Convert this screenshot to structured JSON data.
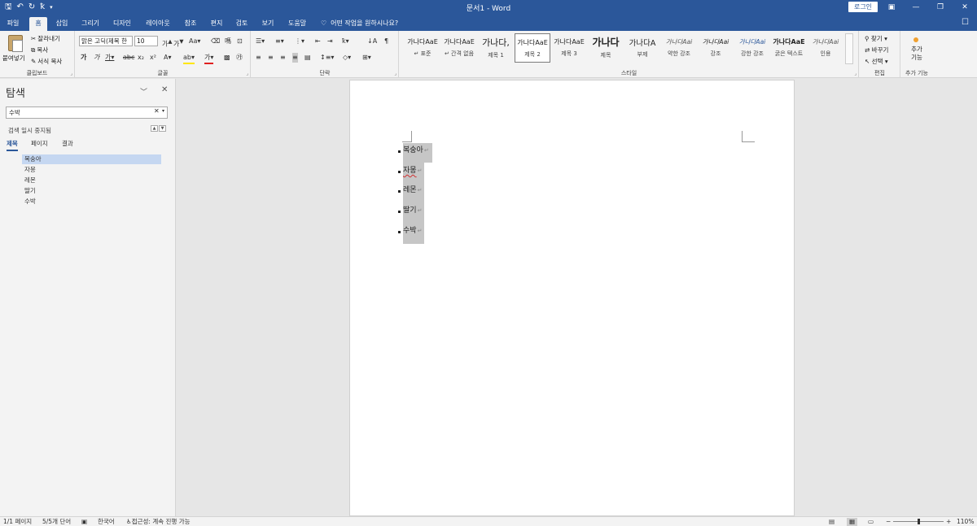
{
  "titlebar": {
    "title": "문서1 - Word",
    "login": "로그인",
    "qat": {
      "save_icon": "save-icon",
      "undo_icon": "undo-icon",
      "redo_icon": "redo-icon",
      "spell_icon": "spellcheck-icon",
      "customize_icon": "customize-icon"
    },
    "colors": {
      "brand": "#2b579a"
    }
  },
  "tabs": [
    "파일",
    "홈",
    "삽입",
    "그리기",
    "디자인",
    "레이아웃",
    "참조",
    "편지",
    "검토",
    "보기",
    "도움말"
  ],
  "tell_me": "어떤 작업을 원하시나요?",
  "ribbon": {
    "clipboard": {
      "paste": "붙여넣기",
      "cut": "잘라내기",
      "copy": "복사",
      "format_painter": "서식 복사",
      "label": "클립보드"
    },
    "font": {
      "name": "맑은 고딕(제목 한",
      "size": "10",
      "label": "글꼴"
    },
    "paragraph": {
      "label": "단락"
    },
    "styles": {
      "label": "스타일",
      "items": [
        {
          "sample": "가나다AaE",
          "name": "↵ 표준"
        },
        {
          "sample": "가나다AaE",
          "name": "↵ 간격 없음"
        },
        {
          "sample": "가나다,",
          "name": "제목 1"
        },
        {
          "sample": "가나다AaE",
          "name": "제목 2"
        },
        {
          "sample": "가나다AaE",
          "name": "제목 3"
        },
        {
          "sample": "가나다",
          "name": "제목"
        },
        {
          "sample": "가나다A",
          "name": "부제"
        },
        {
          "sample": "가나다Aai",
          "name": "약한 강조"
        },
        {
          "sample": "가나다Aai",
          "name": "강조"
        },
        {
          "sample": "가나다Aai",
          "name": "강한 강조"
        },
        {
          "sample": "가나다AaE",
          "name": "굵은 텍스트"
        },
        {
          "sample": "가나다Aai",
          "name": "인용"
        }
      ]
    },
    "editing": {
      "find": "찾기",
      "replace": "바꾸기",
      "select": "선택",
      "label": "편집"
    },
    "addins": {
      "button": "추가 기능",
      "label": "추가 기능"
    }
  },
  "nav": {
    "title": "탐색",
    "search_value": "수박",
    "status": "검색 일시 중지됨",
    "tabs": [
      "제목",
      "페이지",
      "결과"
    ],
    "headings": [
      "복숭아",
      "자몽",
      "레몬",
      "딸기",
      "수박"
    ]
  },
  "document": {
    "paragraphs": [
      "복숭아",
      "자몽",
      "레몬",
      "딸기",
      "수박"
    ],
    "pilcrow": "↵"
  },
  "status": {
    "page": "1/1 페이지",
    "words": "5/5개 단어",
    "language": "한국어",
    "accessibility": "접근성: 계속 진행 가능",
    "zoom": "110%",
    "zoom_minus": "−",
    "zoom_plus": "+"
  }
}
